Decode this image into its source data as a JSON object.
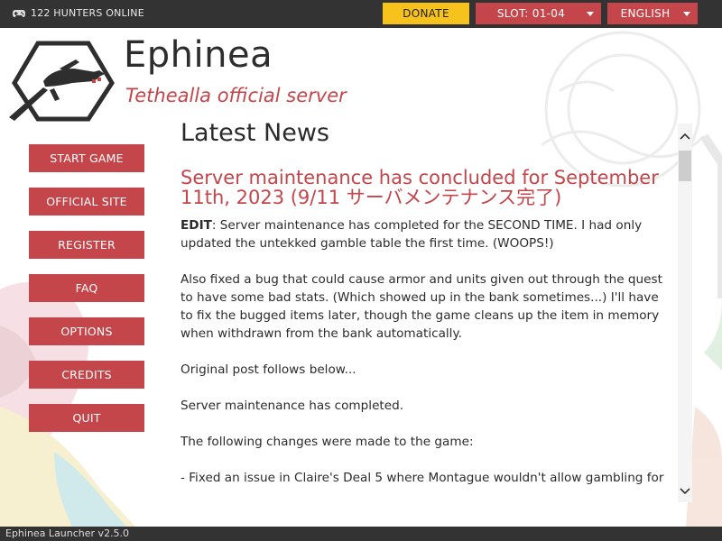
{
  "topbar": {
    "online_text": "122 HUNTERS ONLINE",
    "donate_label": "DONATE",
    "slot_label": "SLOT: 01-04",
    "language_label": "ENGLISH"
  },
  "logo": {
    "title": "Ephinea",
    "subtitle": "Tethealla official server"
  },
  "menu": {
    "items": [
      {
        "label": "START GAME"
      },
      {
        "label": "OFFICIAL SITE"
      },
      {
        "label": "REGISTER"
      },
      {
        "label": "FAQ"
      },
      {
        "label": "OPTIONS"
      },
      {
        "label": "CREDITS"
      },
      {
        "label": "QUIT"
      }
    ]
  },
  "news": {
    "heading": "Latest News",
    "post_title": "Server maintenance has concluded for September 11th, 2023 (9/11 サーバメンテナンス完了)",
    "edit_label": "EDIT",
    "edit_text": ": Server maintenance has completed for the SECOND TIME. I had only updated the untekked gamble table the first time. (WOOPS!)",
    "para2": "Also fixed a bug that could cause armor and units given out through the quest to have some bad stats. (Which showed up in the bank sometimes...) I'll have to fix the bugged items later, though the game cleans up the item in memory when withdrawn from the bank automatically.",
    "para3": "Original post follows below...",
    "para4": "Server maintenance has completed.",
    "para5": "The following changes were made to the game:",
    "para6": "- Fixed an issue in Claire's Deal 5 where Montague wouldn't allow gambling for"
  },
  "status": {
    "version": "Ephinea Launcher v2.5.0"
  },
  "colors": {
    "accent": "#c4454a",
    "donate": "#f8c21d",
    "bar": "#333333"
  }
}
